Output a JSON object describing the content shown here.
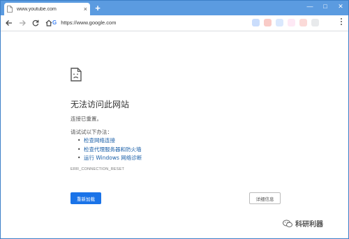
{
  "tab": {
    "title": "www.youtube.com",
    "close": "×"
  },
  "new_tab": "+",
  "window_controls": {
    "minimize": "—",
    "maximize": "□",
    "close": "✕"
  },
  "toolbar": {
    "url": "https://www.google.com",
    "search_engine_letter": "G"
  },
  "extension_colors": [
    "#8ab4f8",
    "#f28b82",
    "#aecbfa",
    "#fdcfe8",
    "#f6aea9",
    "#ccd0d5"
  ],
  "error_page": {
    "headline": "无法访问此网站",
    "subtext": "连接已重置。",
    "try_label": "请试试以下办法：",
    "suggestions": [
      "检查网络连接",
      "检查代理服务器和防火墙",
      "运行 Windows 网络诊断"
    ],
    "error_code": "ERR_CONNECTION_RESET",
    "reload_label": "重新加载",
    "details_label": "详细信息"
  },
  "watermark": {
    "text": "科研利器"
  },
  "colors": {
    "accent": "#1a73e8",
    "link": "#1a5fa8",
    "tabstrip": "#5b9be0"
  }
}
